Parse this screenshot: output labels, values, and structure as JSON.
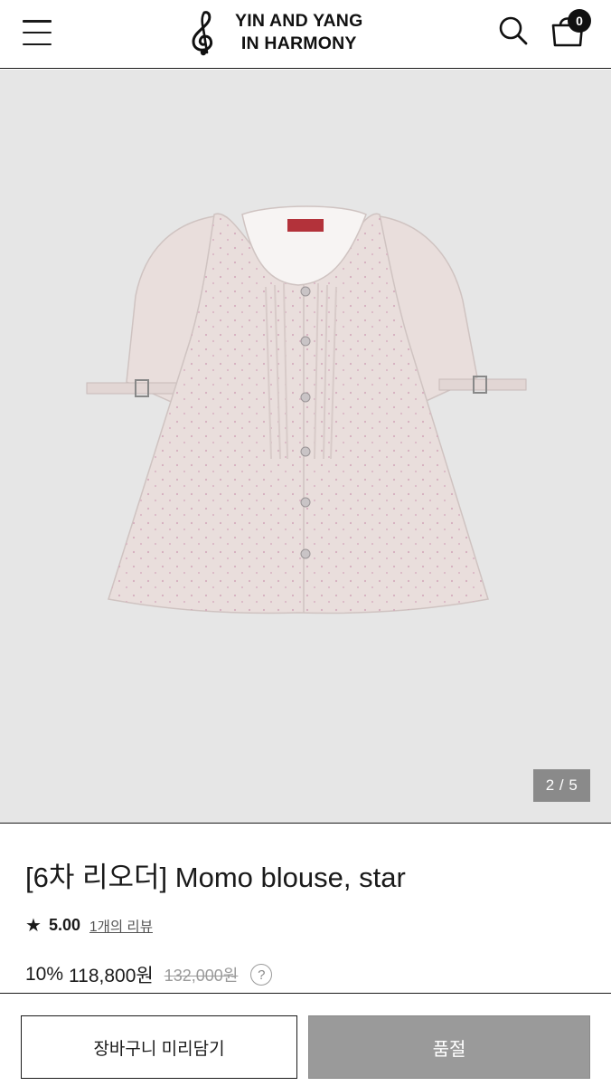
{
  "header": {
    "brand_line1": "YIN AND YANG",
    "brand_line2": "IN HARMONY",
    "cart_count": "0",
    "icons": {
      "menu": "hamburger-menu-icon",
      "logo": "treble-clef-icon",
      "search": "search-icon",
      "cart": "shopping-bag-icon"
    }
  },
  "gallery": {
    "image": "pink star-print blouse with pintucked front and buttoned cuff straps",
    "pager": "2 / 5"
  },
  "product": {
    "title": "[6차 리오더] Momo blouse, star",
    "star": "★",
    "rating": "5.00",
    "review_link": "1개의 리뷰",
    "discount": "10%",
    "price": "118,800원",
    "original_price": "132,000원",
    "help": "?"
  },
  "actions": {
    "add_to_cart": "장바구니 미리담기",
    "sold_out": "품절"
  },
  "colors": {
    "text": "#1a1a1a",
    "gallery_bg": "#e6e6e6",
    "sold_out_bg": "#9a9a9a",
    "blouse": "#e9dedc"
  }
}
